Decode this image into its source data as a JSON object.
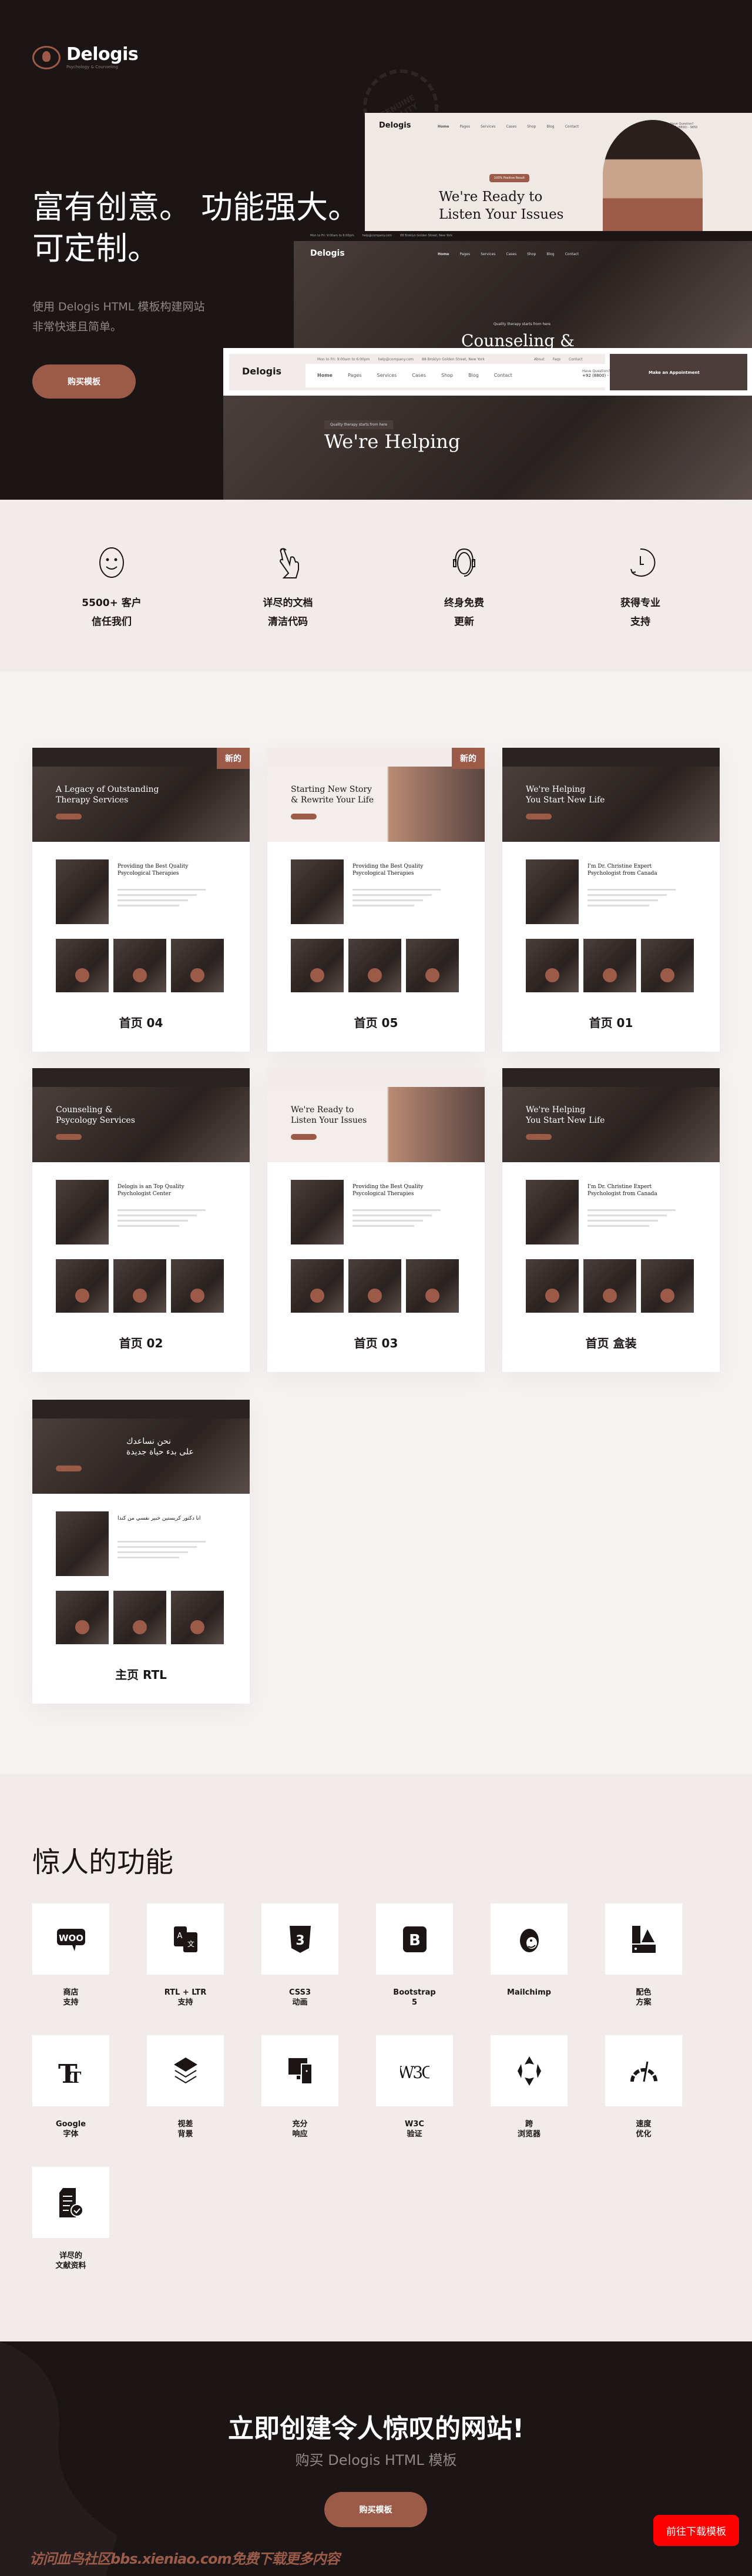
{
  "colors": {
    "accent": "#9c5b48",
    "dark": "#1b1516",
    "light": "#f1ecea",
    "download": "#ff0000"
  },
  "hero": {
    "logo": {
      "name": "Delogis",
      "tagline": "Psychology & Counseling"
    },
    "title_lines": [
      "富有创意。 功能强大。",
      "可定制。"
    ],
    "subtitle_lines": [
      "使用 Delogis HTML 模板构建网站",
      "非常快速且简单。"
    ],
    "button": "购买模板",
    "stamp_text": "GENUINE QUALITY",
    "mockups": {
      "nav": [
        "Home",
        "Pages",
        "Services",
        "Cases",
        "Shop",
        "Blog",
        "Contact"
      ],
      "phone_label": "Have Question?",
      "phone": "+92 (8800) - 9850",
      "topbar": {
        "hours": "Mon to Fri: 9:00am to 6:00pm",
        "email": "help@company.com",
        "address": "88 Broklyn Golden Street, New York",
        "links": [
          "About",
          "Faqs",
          "Contact"
        ]
      },
      "a": {
        "badge": "100% Positive Result",
        "headline": [
          "We're Ready to",
          "Listen Your Issues"
        ]
      },
      "b": {
        "tagline": "Quality therapy starts from here",
        "headline": "Counseling &"
      },
      "c": {
        "tagline": "Quality therapy starts from here",
        "headline": "We're Helping",
        "appointment": "Make an Appointment"
      }
    }
  },
  "highlights": [
    {
      "icon": "smiley-icon",
      "lines": [
        "5500+ 客户",
        "信任我们"
      ]
    },
    {
      "icon": "hand-pointer-icon",
      "lines": [
        "详尽的文档",
        "清洁代码"
      ]
    },
    {
      "icon": "headset-icon",
      "lines": [
        "终身免费",
        "更新"
      ]
    },
    {
      "icon": "clock-icon",
      "lines": [
        "获得专业",
        "支持"
      ]
    }
  ],
  "demos": [
    {
      "label": "首页 04",
      "badge": "新的",
      "theme": "dark",
      "headline": [
        "A Legacy of Outstanding",
        "Therapy Services"
      ],
      "section": "Providing the Best Quality Psycological Therapies"
    },
    {
      "label": "首页 05",
      "badge": "新的",
      "theme": "light",
      "headline": [
        "Starting New Story",
        "& Rewrite Your Life"
      ],
      "section": "Providing the Best Quality Psycological Therapies"
    },
    {
      "label": "首页 01",
      "badge": "",
      "theme": "dark",
      "headline": [
        "We're Helping",
        "You Start New Life"
      ],
      "section": "I'm Dr. Christine Expert Psychologist from Canada"
    },
    {
      "label": "首页 02",
      "badge": "",
      "theme": "dark",
      "headline": [
        "Counseling &",
        "Psycology Services"
      ],
      "section": "Delogis is an Top Quality Psychologist Center"
    },
    {
      "label": "首页 03",
      "badge": "",
      "theme": "light",
      "headline": [
        "We're Ready to",
        "Listen Your Issues"
      ],
      "section": "Providing the Best Quality Psycological Therapies"
    },
    {
      "label": "首页 盒装",
      "badge": "",
      "theme": "dark",
      "headline": [
        "We're Helping",
        "You Start New Life"
      ],
      "section": "I'm Dr. Christine Expert Psychologist from Canada"
    },
    {
      "label": "主页 RTL",
      "badge": "",
      "theme": "dark",
      "headline": [
        "نحن نساعدك",
        "على بدء حياة جديدة"
      ],
      "section": "انا دكتور كريستين خبير نفسي من كندا"
    }
  ],
  "features": {
    "title": "惊人的功能",
    "items": [
      {
        "icon": "woocommerce-icon",
        "label": "商店\n支持"
      },
      {
        "icon": "translate-icon",
        "label": "RTL + LTR\n支持"
      },
      {
        "icon": "css3-icon",
        "label": "CSS3\n动画"
      },
      {
        "icon": "bootstrap-icon",
        "label": "Bootstrap\n5"
      },
      {
        "icon": "mailchimp-icon",
        "label": "Mailchimp"
      },
      {
        "icon": "color-palette-icon",
        "label": "配色\n方案"
      },
      {
        "icon": "font-icon",
        "label": "Google\n字体"
      },
      {
        "icon": "layers-icon",
        "label": "视差\n背景"
      },
      {
        "icon": "responsive-devices-icon",
        "label": "充分\n响应"
      },
      {
        "icon": "w3c-icon",
        "label": "W3C\n验证"
      },
      {
        "icon": "cross-browser-icon",
        "label": "跨\n浏览器"
      },
      {
        "icon": "speedometer-icon",
        "label": "速度\n优化"
      },
      {
        "icon": "document-check-icon",
        "label": "详尽的\n文献资料"
      }
    ]
  },
  "cta": {
    "title": "立即创建令人惊叹的网站!",
    "subtitle": "购买 Delogis HTML 模板",
    "button": "购买模板"
  },
  "floating_button": "前往下载模板",
  "watermark": "访问血鸟社区bbs.xieniao.com免费下载更多内容"
}
